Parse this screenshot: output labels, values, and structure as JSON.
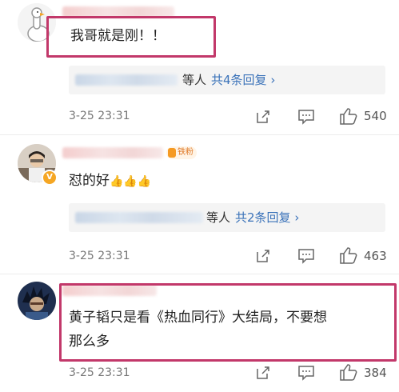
{
  "comments": [
    {
      "text": "我哥就是刚！！",
      "reply_who": "等人",
      "reply_count": "共4条回复 ›",
      "date": "3-25 23:31",
      "likes": "540"
    },
    {
      "fan_badge": "铁粉",
      "text": "怼的好",
      "emoji": "👍👍👍",
      "reply_who": "等人",
      "reply_count": "共2条回复 ›",
      "date": "3-25 23:31",
      "likes": "463"
    },
    {
      "text_line1": "黄子韬只是看《热血同行》大结局，不要想",
      "text_line2": "那么多",
      "date": "3-25 23:31",
      "likes": "384"
    }
  ],
  "icons": {
    "share": "share-icon",
    "comment": "comment-icon",
    "like": "thumbs-up-icon"
  },
  "colors": {
    "highlight": "#c2386a",
    "link": "#3a72b9",
    "badge": "#f5a623"
  }
}
